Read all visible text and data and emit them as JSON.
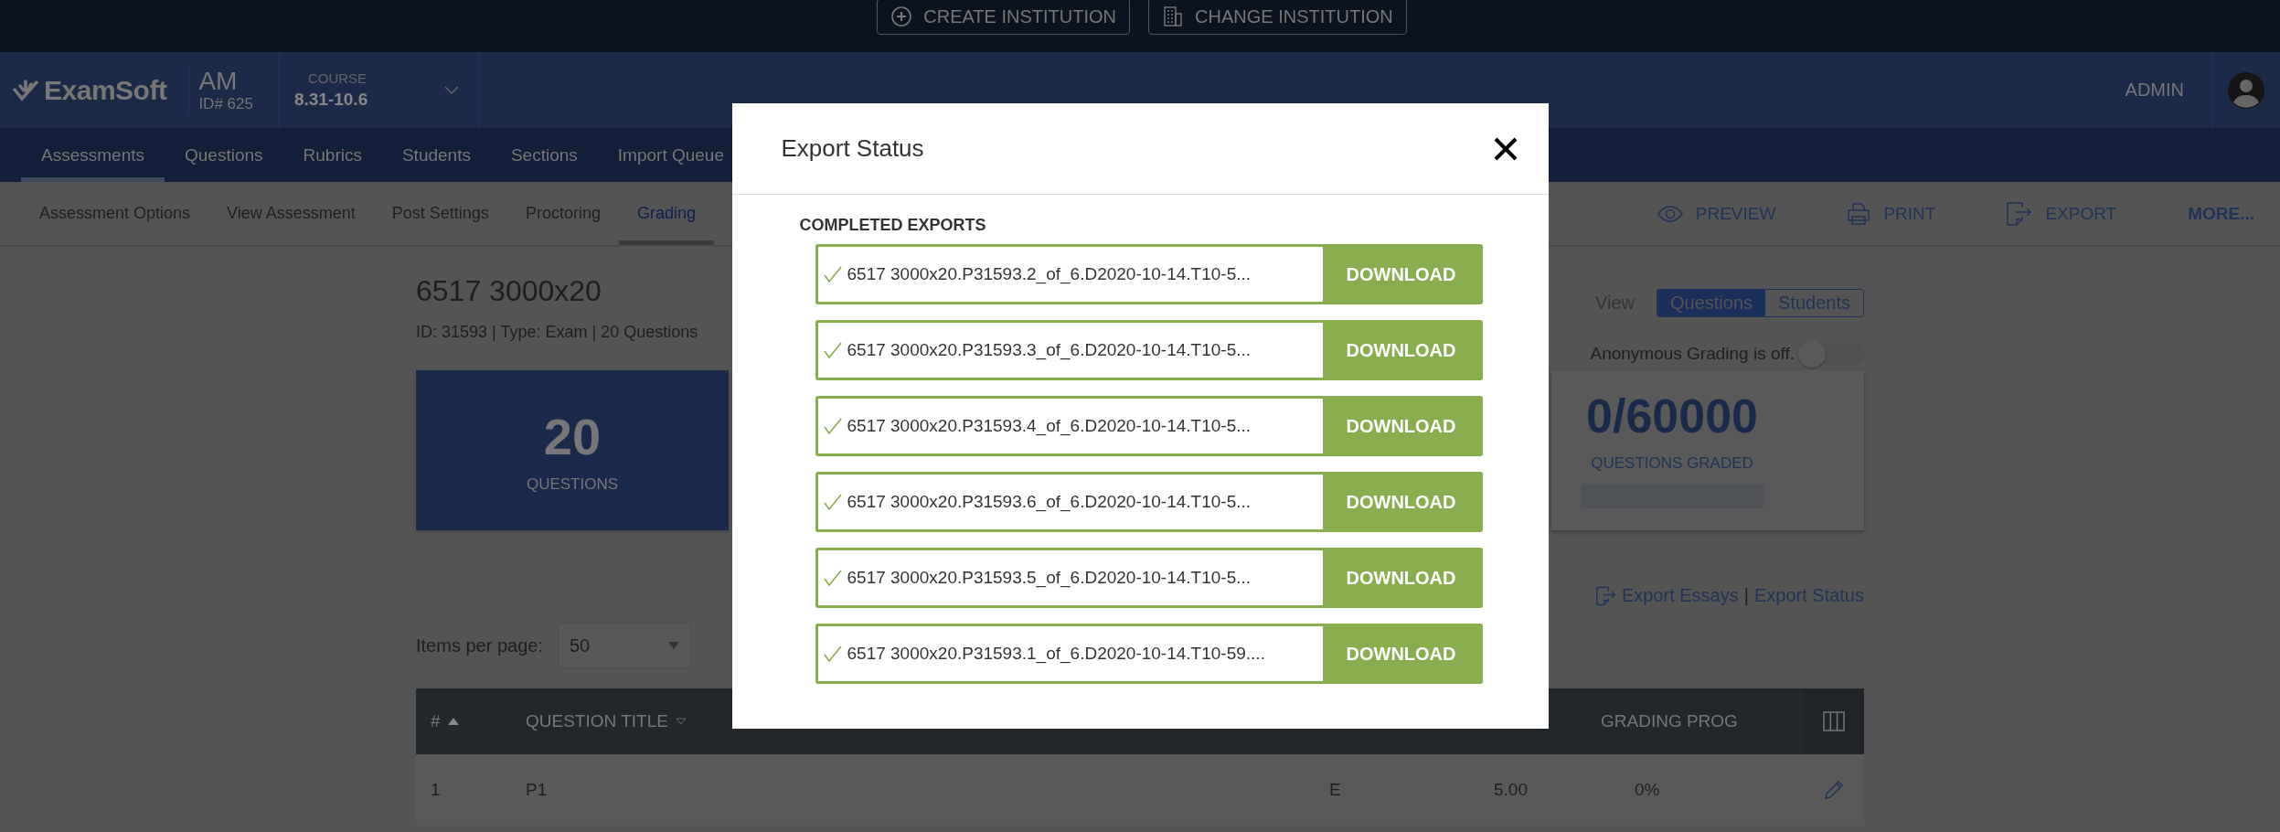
{
  "top_bar": {
    "buttons": [
      {
        "label": "CREATE INSTITUTION",
        "kind": "create"
      },
      {
        "label": "CHANGE INSTITUTION",
        "kind": "change"
      }
    ]
  },
  "header": {
    "logo": "ExamSoft",
    "institution": {
      "code": "AM",
      "id": "ID# 625"
    },
    "course": {
      "label": "COURSE",
      "value": "8.31-10.6"
    },
    "user": "ADMIN"
  },
  "nav": [
    {
      "label": "Assessments",
      "selected": true
    },
    {
      "label": "Questions",
      "selected": false
    },
    {
      "label": "Rubrics",
      "selected": false
    },
    {
      "label": "Students",
      "selected": false
    },
    {
      "label": "Sections",
      "selected": false
    },
    {
      "label": "Import Queue",
      "selected": false
    }
  ],
  "subnav": [
    {
      "label": "Assessment Options",
      "selected": false
    },
    {
      "label": "View Assessment",
      "selected": false
    },
    {
      "label": "Post Settings",
      "selected": false
    },
    {
      "label": "Proctoring",
      "selected": false
    },
    {
      "label": "Grading",
      "selected": true
    }
  ],
  "actions": [
    {
      "label": "PREVIEW",
      "kind": "preview"
    },
    {
      "label": "PRINT",
      "kind": "print"
    },
    {
      "label": "EXPORT",
      "kind": "export"
    },
    {
      "label": "MORE...",
      "kind": "more"
    }
  ],
  "assessment": {
    "title": "6517 3000x20",
    "meta": "ID: 31593 | Type: Exam | 20 Questions"
  },
  "view": {
    "label": "View",
    "options": [
      {
        "label": "Questions",
        "selected": true
      },
      {
        "label": "Students",
        "selected": false
      }
    ]
  },
  "anonymous_grading": {
    "label": "Anonymous Grading is off.",
    "on": false
  },
  "stats": [
    {
      "value": "20",
      "label": "QUESTIONS",
      "kind": "count"
    },
    {
      "value": "0/60000",
      "label": "QUESTIONS GRADED",
      "kind": "progress",
      "level": 0
    }
  ],
  "export_links": {
    "links": [
      {
        "label": "Export Essays"
      },
      {
        "label": "Export Status"
      }
    ],
    "separator": "|"
  },
  "items_per_page": {
    "label": "Items per page:",
    "value": "50"
  },
  "table": {
    "columns": [
      {
        "label": "#",
        "sorted": true
      },
      {
        "label": "QUESTION TITLE",
        "sorted": false
      },
      null,
      null,
      {
        "label": "GRADING PROG"
      }
    ],
    "rows": [
      {
        "cells": [
          "1",
          "P1",
          "E",
          "5.00",
          "0%"
        ]
      }
    ]
  },
  "modal": {
    "title": "Export Status",
    "section": "COMPLETED EXPORTS",
    "exports": [
      {
        "name": "6517 3000x20.P31593.2_of_6.D2020-10-14.T10-5...",
        "completed": true,
        "action": "DOWNLOAD"
      },
      {
        "name": "6517 3000x20.P31593.3_of_6.D2020-10-14.T10-5...",
        "completed": true,
        "action": "DOWNLOAD"
      },
      {
        "name": "6517 3000x20.P31593.4_of_6.D2020-10-14.T10-5...",
        "completed": true,
        "action": "DOWNLOAD"
      },
      {
        "name": "6517 3000x20.P31593.6_of_6.D2020-10-14.T10-5...",
        "completed": true,
        "action": "DOWNLOAD"
      },
      {
        "name": "6517 3000x20.P31593.5_of_6.D2020-10-14.T10-5...",
        "completed": true,
        "action": "DOWNLOAD"
      },
      {
        "name": "6517 3000x20.P31593.1_of_6.D2020-10-14.T10-59....",
        "completed": true,
        "action": "DOWNLOAD"
      }
    ]
  }
}
